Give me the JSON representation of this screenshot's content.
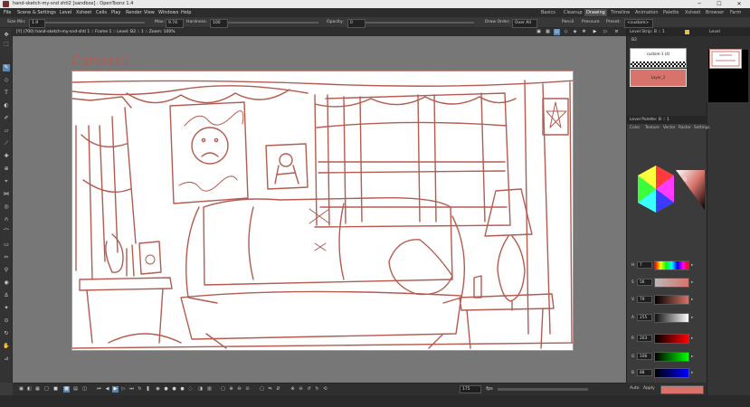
{
  "titlebar": {
    "title": "hand-sketch-my-snd shtl2 [sandbox] : OpenToonz 1.4",
    "min": "─",
    "max": "☐",
    "close": "✕"
  },
  "menu": [
    "File",
    "Scene & Settings",
    "Level",
    "Xsheet",
    "Cells",
    "Play",
    "Render",
    "View",
    "Windows",
    "Help"
  ],
  "rooms": [
    {
      "label": "Basics",
      "active": false
    },
    {
      "label": "Cleanup",
      "active": false
    },
    {
      "label": "Drawing",
      "active": true
    },
    {
      "label": "Timeline",
      "active": false
    },
    {
      "label": "Animation",
      "active": false
    },
    {
      "label": "Palette",
      "active": false
    },
    {
      "label": "Xsheet",
      "active": false
    },
    {
      "label": "Browser",
      "active": false
    },
    {
      "label": "Farm",
      "active": false
    }
  ],
  "tool_options": {
    "size_label": "Size Min:",
    "size_value": "1.9",
    "max_label": "Max:",
    "max_value": "9.74",
    "hardness_label": "Hardness:",
    "hardness_value": "100",
    "opacity_label": "Opacity:",
    "opacity_value": "0",
    "draw_order_label": "Draw Order:",
    "draw_order_value": "Over All",
    "pencil_label": "Pencil",
    "pressure_label": "Pressure",
    "preset_label": "Preset:",
    "preset_value": "<custom>"
  },
  "viewer": {
    "header_text": "[Y] (700) hand-sketch-my-snd-shtl 1  ::  Frame 1  ::  Level: B2 :: 1  ::  Zoom: 100%",
    "camera_label": "Camera1",
    "frame_value": "175",
    "fps_label": "fps"
  },
  "level_strip": {
    "header": "Level Strip: B :: 1",
    "level_name": "B2",
    "frame1_caption": "custom-1 (4)",
    "frame2_caption": "Layer_1"
  },
  "level_panel": {
    "header": "Level"
  },
  "style_editor": {
    "header": "Level Palette: B :: 1",
    "tabs": [
      "Color",
      "Texture",
      "Vector",
      "Raster",
      "Settings"
    ],
    "channels": [
      {
        "label": "H",
        "value": "7",
        "gradient": "linear-gradient(90deg,#f00,#ff0,#0f0,#0ff,#00f,#f0f,#f00)"
      },
      {
        "label": "S",
        "value": "56",
        "gradient": "linear-gradient(90deg,#b9b9b9,#d7736a)"
      },
      {
        "label": "V",
        "value": "79",
        "gradient": "linear-gradient(90deg,#000,#d7736a)"
      },
      {
        "label": "A",
        "value": "255",
        "gradient": "linear-gradient(90deg,#111,#fff)"
      },
      {
        "label": "R",
        "value": "203",
        "gradient": "linear-gradient(90deg,#000,#f00)"
      },
      {
        "label": "G",
        "value": "106",
        "gradient": "linear-gradient(90deg,#000,#0f0)"
      },
      {
        "label": "B",
        "value": "88",
        "gradient": "linear-gradient(90deg,#000,#00f)"
      }
    ],
    "auto_label": "Auto",
    "apply_label": "Apply",
    "current_color": "#d7736a"
  },
  "colors": {
    "accent": "#5a86b0",
    "sketch": "#b45b50",
    "viewer_bg": "#777777"
  }
}
